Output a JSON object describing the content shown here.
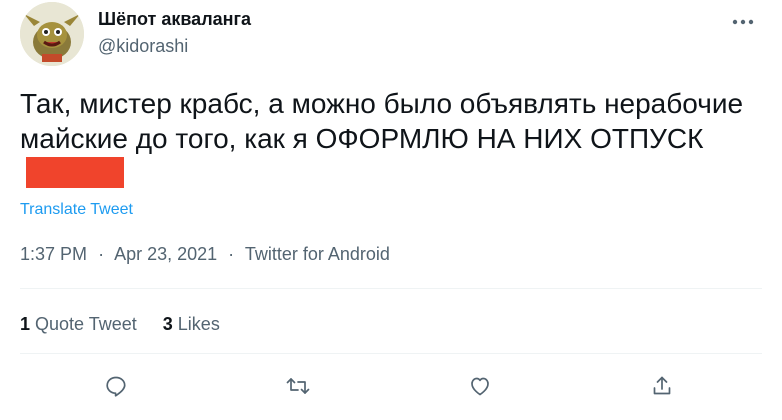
{
  "author": {
    "display_name": "Шёпот акваланга",
    "handle": "@kidorashi",
    "avatar_icon": "goblin-avatar"
  },
  "tweet": {
    "text": "Так, мистер крабс, а можно было объявлять нерабочие майские до того, как я ОФОРМЛЮ НА НИХ ОТПУСК",
    "redaction_color": "#f0442c",
    "translate_label": "Translate Tweet"
  },
  "meta": {
    "time": "1:37 PM",
    "separator": "·",
    "date": "Apr 23, 2021",
    "source": "Twitter for Android"
  },
  "stats": {
    "quote_count": "1",
    "quote_label": "Quote Tweet",
    "like_count": "3",
    "like_label": "Likes"
  },
  "actions": {
    "reply_icon": "reply-icon",
    "retweet_icon": "retweet-icon",
    "like_icon": "heart-icon",
    "share_icon": "share-icon"
  },
  "colors": {
    "link": "#1d9bf0",
    "secondary_text": "#536471",
    "primary_text": "#0f1419"
  }
}
